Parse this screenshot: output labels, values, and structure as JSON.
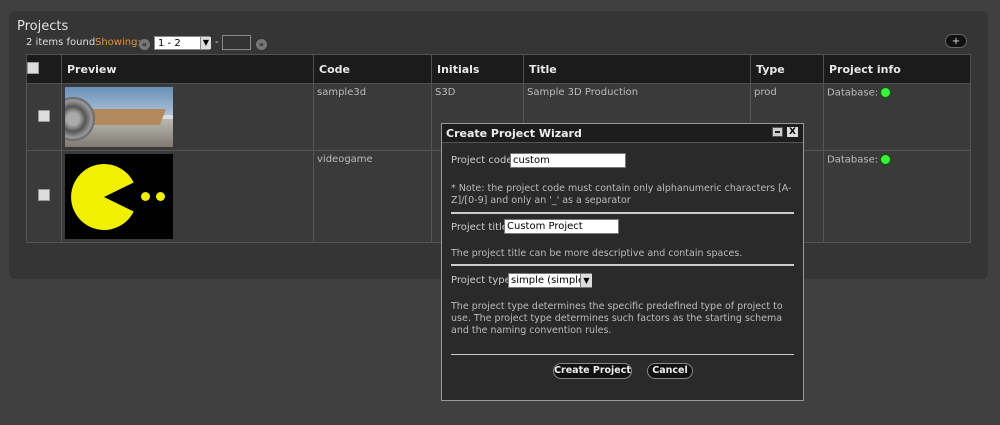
{
  "panel": {
    "title": "Projects"
  },
  "pagination": {
    "items_found": "2 items found",
    "showing_label": "Showing:",
    "range_value": "1 - 2",
    "dash": "-",
    "page_value": "",
    "prev_icon": "«",
    "next_icon": "»"
  },
  "toolbar": {
    "add_label": "+"
  },
  "table": {
    "columns": [
      "Preview",
      "Code",
      "Initials",
      "Title",
      "Type",
      "Project info"
    ],
    "rows": [
      {
        "code": "sample3d",
        "initials": "S3D",
        "title": "Sample 3D Production",
        "type": "prod",
        "info": "Database:",
        "status_color": "#3cf23c"
      },
      {
        "code": "videogame",
        "initials": "",
        "title": "",
        "type": "",
        "info": "Database:",
        "status_color": "#3cf23c"
      }
    ]
  },
  "wizard": {
    "title": "Create Project Wizard",
    "code_label": "Project code:",
    "code_value": "custom",
    "code_note": "* Note: the project code must contain only alphanumeric characters [A-Z]/[0-9] and only an '_' as a separator",
    "title_label": "Project title:",
    "title_value": "Custom Project",
    "title_note": "The project title can be more descriptive and contain spaces.",
    "type_label": "Project type:",
    "type_value": "simple (simple)",
    "type_note": "The project type determines the specific predefined type of project to use. The project type determines such factors as the starting schema and the naming convention rules.",
    "create_label": "Create Project",
    "cancel_label": "Cancel",
    "close_glyph": "X"
  }
}
